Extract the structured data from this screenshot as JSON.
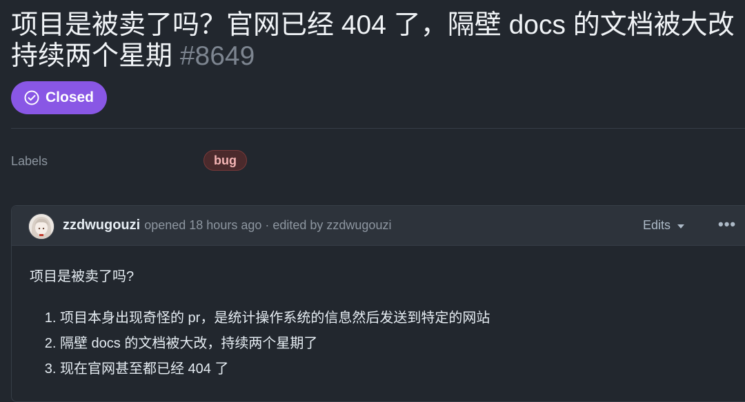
{
  "issue": {
    "title": "项目是被卖了吗？官网已经 404 了，隔壁 docs 的文档被大改持续两个星期",
    "number": "#8649",
    "state": "Closed",
    "state_color": "#8957e5"
  },
  "sidebar": {
    "labels_title": "Labels",
    "labels": [
      {
        "name": "bug",
        "color": "#f4b4b4"
      }
    ]
  },
  "comment": {
    "author": "zzdwugouzi",
    "meta": "opened 18 hours ago · edited by zzdwugouzi",
    "edits_label": "Edits",
    "more_label": "•••",
    "intro": "项目是被卖了吗?",
    "items": [
      "项目本身出现奇怪的 pr，是统计操作系统的信息然后发送到特定的网站",
      "隔壁 docs 的文档被大改，持续两个星期了",
      "现在官网甚至都已经 404 了"
    ]
  }
}
